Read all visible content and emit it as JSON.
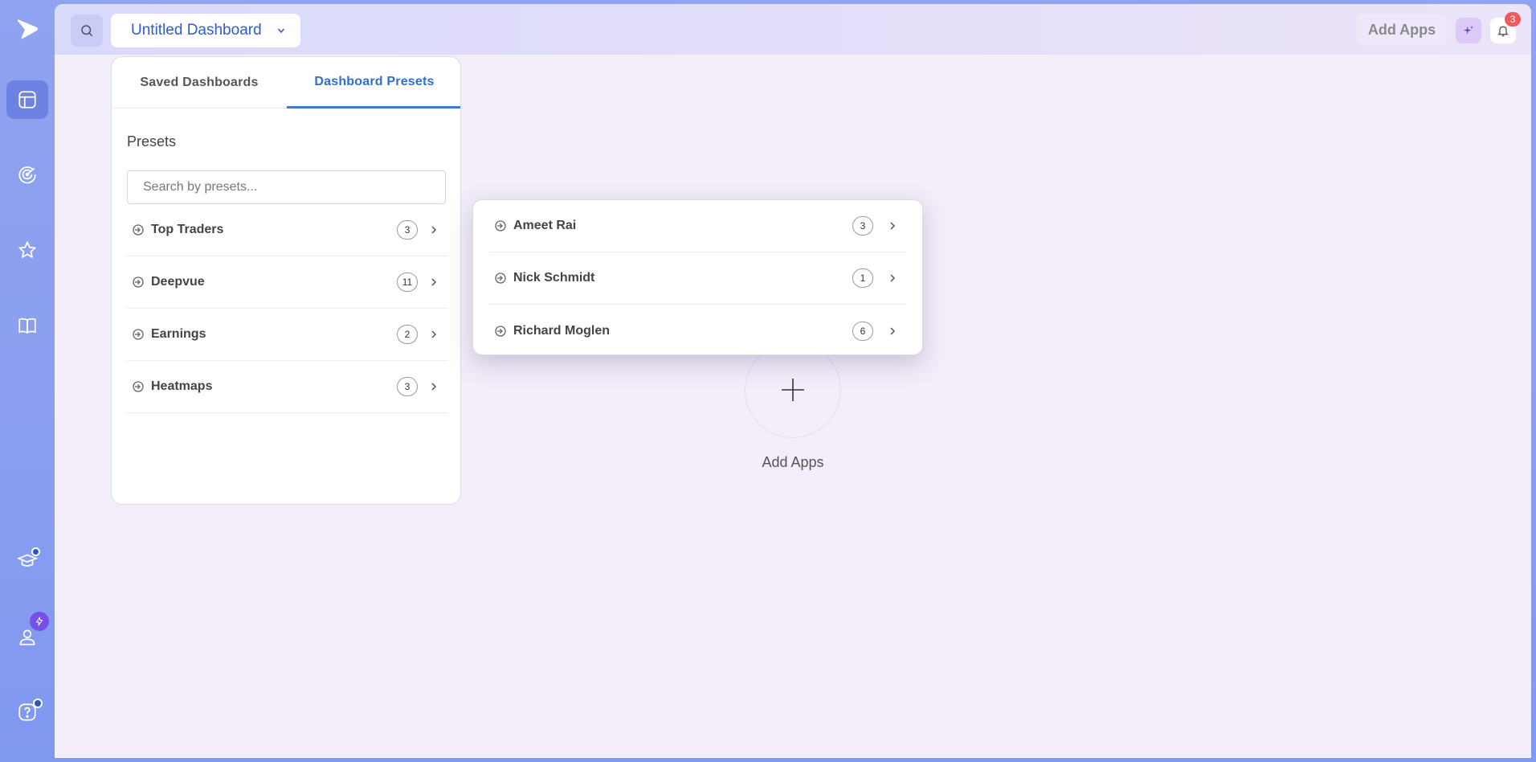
{
  "header": {
    "dashboard_title": "Untitled Dashboard",
    "add_apps_label": "Add Apps",
    "notification_count": "3"
  },
  "sidebar": {
    "items": [
      {
        "name": "dashboard",
        "icon": "dashboard-icon",
        "active": true
      },
      {
        "name": "radar",
        "icon": "radar-icon",
        "active": false
      },
      {
        "name": "favorites",
        "icon": "star-icon",
        "active": false
      },
      {
        "name": "learn",
        "icon": "book-icon",
        "active": false
      },
      {
        "name": "education",
        "icon": "graduation-cap-icon",
        "active": false
      },
      {
        "name": "profile",
        "icon": "user-icon",
        "active": false
      },
      {
        "name": "help",
        "icon": "help-icon",
        "active": false
      }
    ]
  },
  "dropdown": {
    "tabs": [
      {
        "label": "Saved Dashboards",
        "active": false
      },
      {
        "label": "Dashboard Presets",
        "active": true
      }
    ],
    "section_title": "Presets",
    "search_placeholder": "Search by presets...",
    "presets": [
      {
        "label": "Top Traders",
        "count": "3"
      },
      {
        "label": "Deepvue",
        "count": "11"
      },
      {
        "label": "Earnings",
        "count": "2"
      },
      {
        "label": "Heatmaps",
        "count": "3"
      }
    ]
  },
  "subpanel": {
    "items": [
      {
        "label": "Ameet Rai",
        "count": "3"
      },
      {
        "label": "Nick Schmidt",
        "count": "1"
      },
      {
        "label": "Richard Moglen",
        "count": "6"
      }
    ]
  },
  "empty_state": {
    "add_apps_label": "Add Apps"
  },
  "colors": {
    "accent": "#2f5bcf",
    "tab_active": "#3d79d6",
    "badge_red": "#ef5a5a",
    "sidebar": "#8c9ff0"
  }
}
